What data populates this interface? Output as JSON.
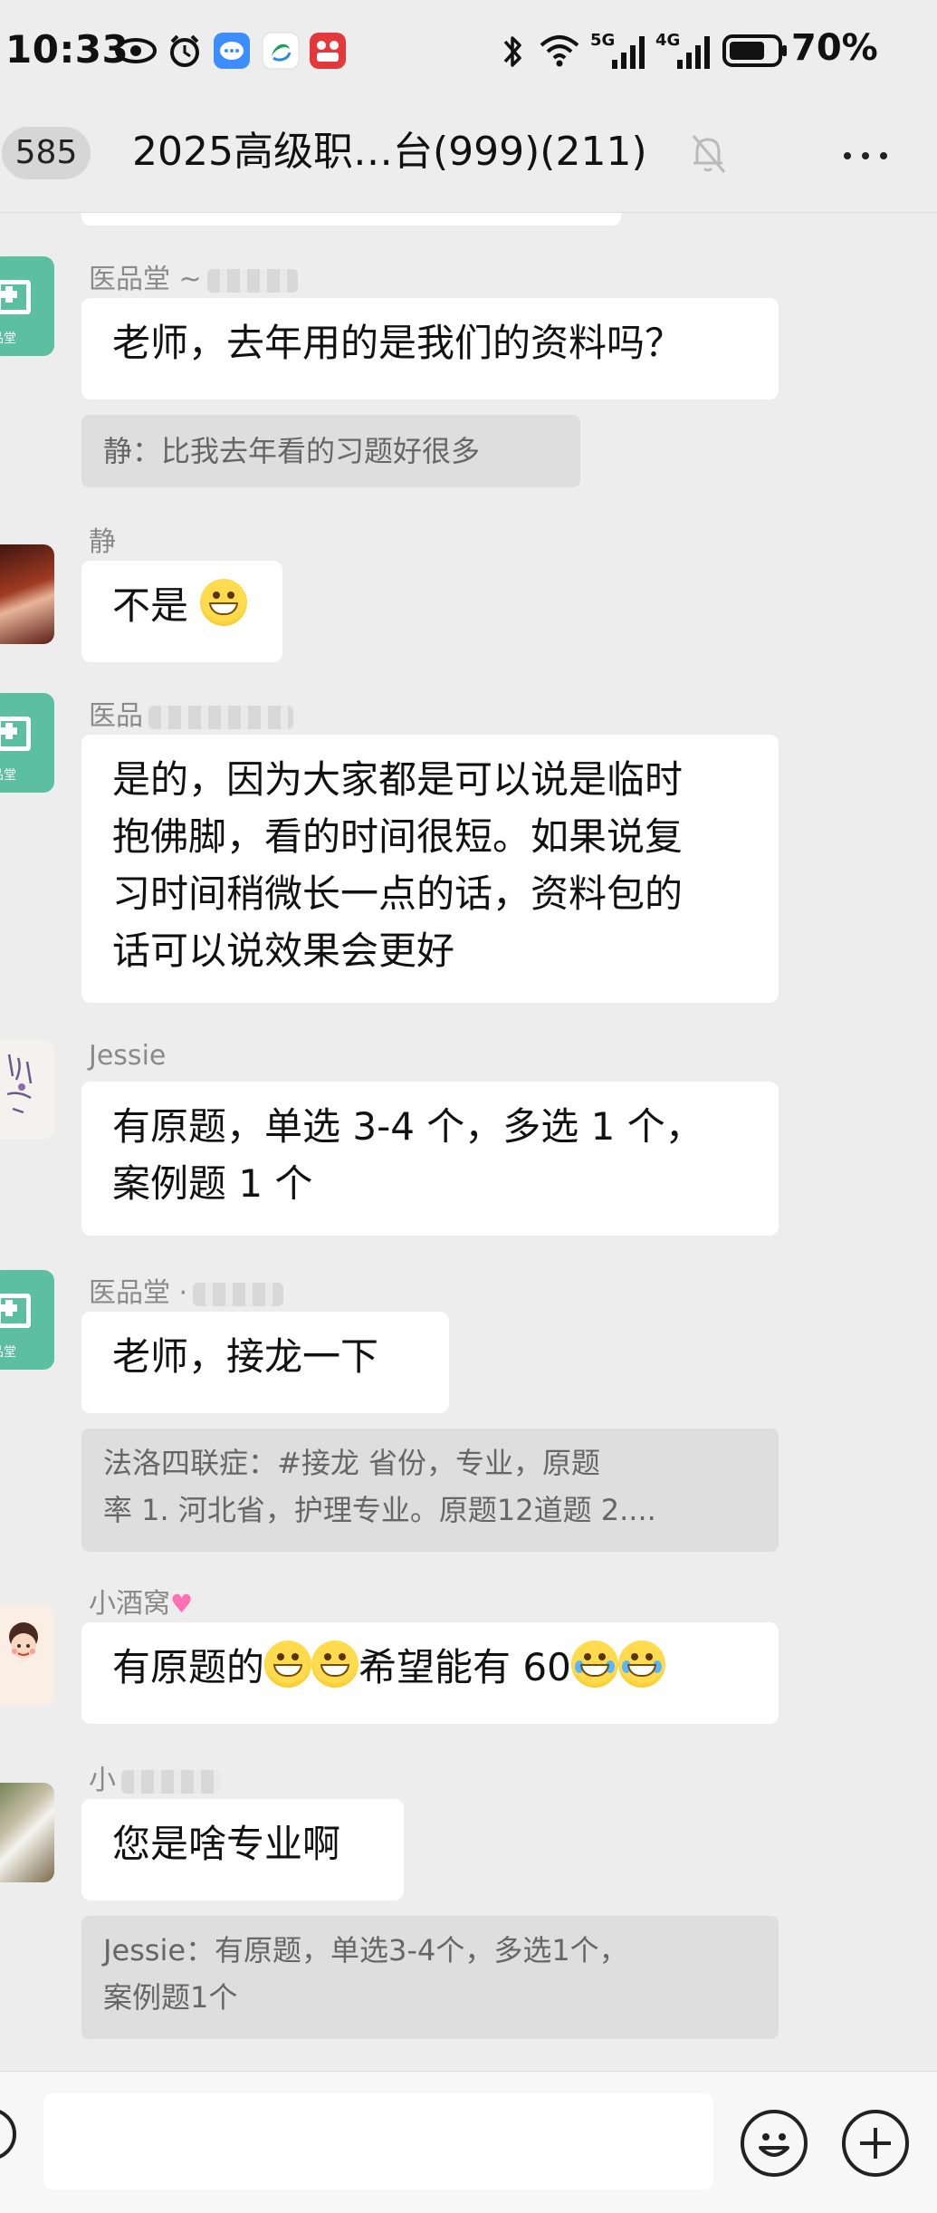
{
  "status_bar": {
    "time": "10:33",
    "icons": [
      "eye-icon",
      "alarm-icon",
      "message-app-icon",
      "china-mobile-icon",
      "shopping-app-icon",
      "bluetooth-icon",
      "wifi-icon",
      "signal-5g-icon",
      "signal-4g-icon",
      "battery-icon"
    ],
    "network_5g": "5G",
    "network_4g": "4G",
    "battery": "70%"
  },
  "header": {
    "unread_count": "585",
    "title": "2025高级职…台(999)(211)",
    "mute_icon": "bell-off-icon",
    "more_icon": "more-dots-icon"
  },
  "messages": [
    {
      "sender": "医品堂 ~",
      "avatar": "clinic-logo",
      "avatar_text": "品堂",
      "text": "老师，去年用的是我们的资料吗？",
      "quote": "静：比我去年看的习题好很多"
    },
    {
      "sender": "静",
      "avatar": "photo",
      "text": "不是",
      "emoji": "grin-emoji"
    },
    {
      "sender": "医品",
      "avatar": "clinic-logo",
      "avatar_text": "品堂",
      "lines": [
        "是的，因为大家都是可以说是临时",
        "抱佛脚，看的时间很短。如果说复",
        "习时间稍微长一点的话，资料包的",
        "话可以说效果会更好"
      ]
    },
    {
      "sender": "Jessie",
      "avatar": "sketch",
      "lines": [
        "有原题，单选 3-4 个，多选 1 个，",
        "案例题 1 个"
      ]
    },
    {
      "sender": "医品堂 ·",
      "avatar": "clinic-logo",
      "avatar_text": "品堂",
      "text": "老师，接龙一下",
      "quote_lines": [
        "法洛四联症：#接龙 省份，专业，原题",
        "率  1. 河北省，护理专业。原题12道题 2...."
      ]
    },
    {
      "sender": "小酒窝",
      "avatar": "cartoon",
      "text_before": "有原题的",
      "text_after": "希望能有 60"
    },
    {
      "sender": "小",
      "avatar": "dog-photo",
      "text": "您是啥专业啊",
      "quote_lines": [
        "Jessie：有原题，单选3-4个，多选1个，",
        "案例题1个"
      ]
    }
  ],
  "input_bar": {
    "voice_icon": "voice-icon",
    "emoji_icon": "emoji-icon",
    "add_icon": "plus-circle-icon",
    "value": ""
  }
}
